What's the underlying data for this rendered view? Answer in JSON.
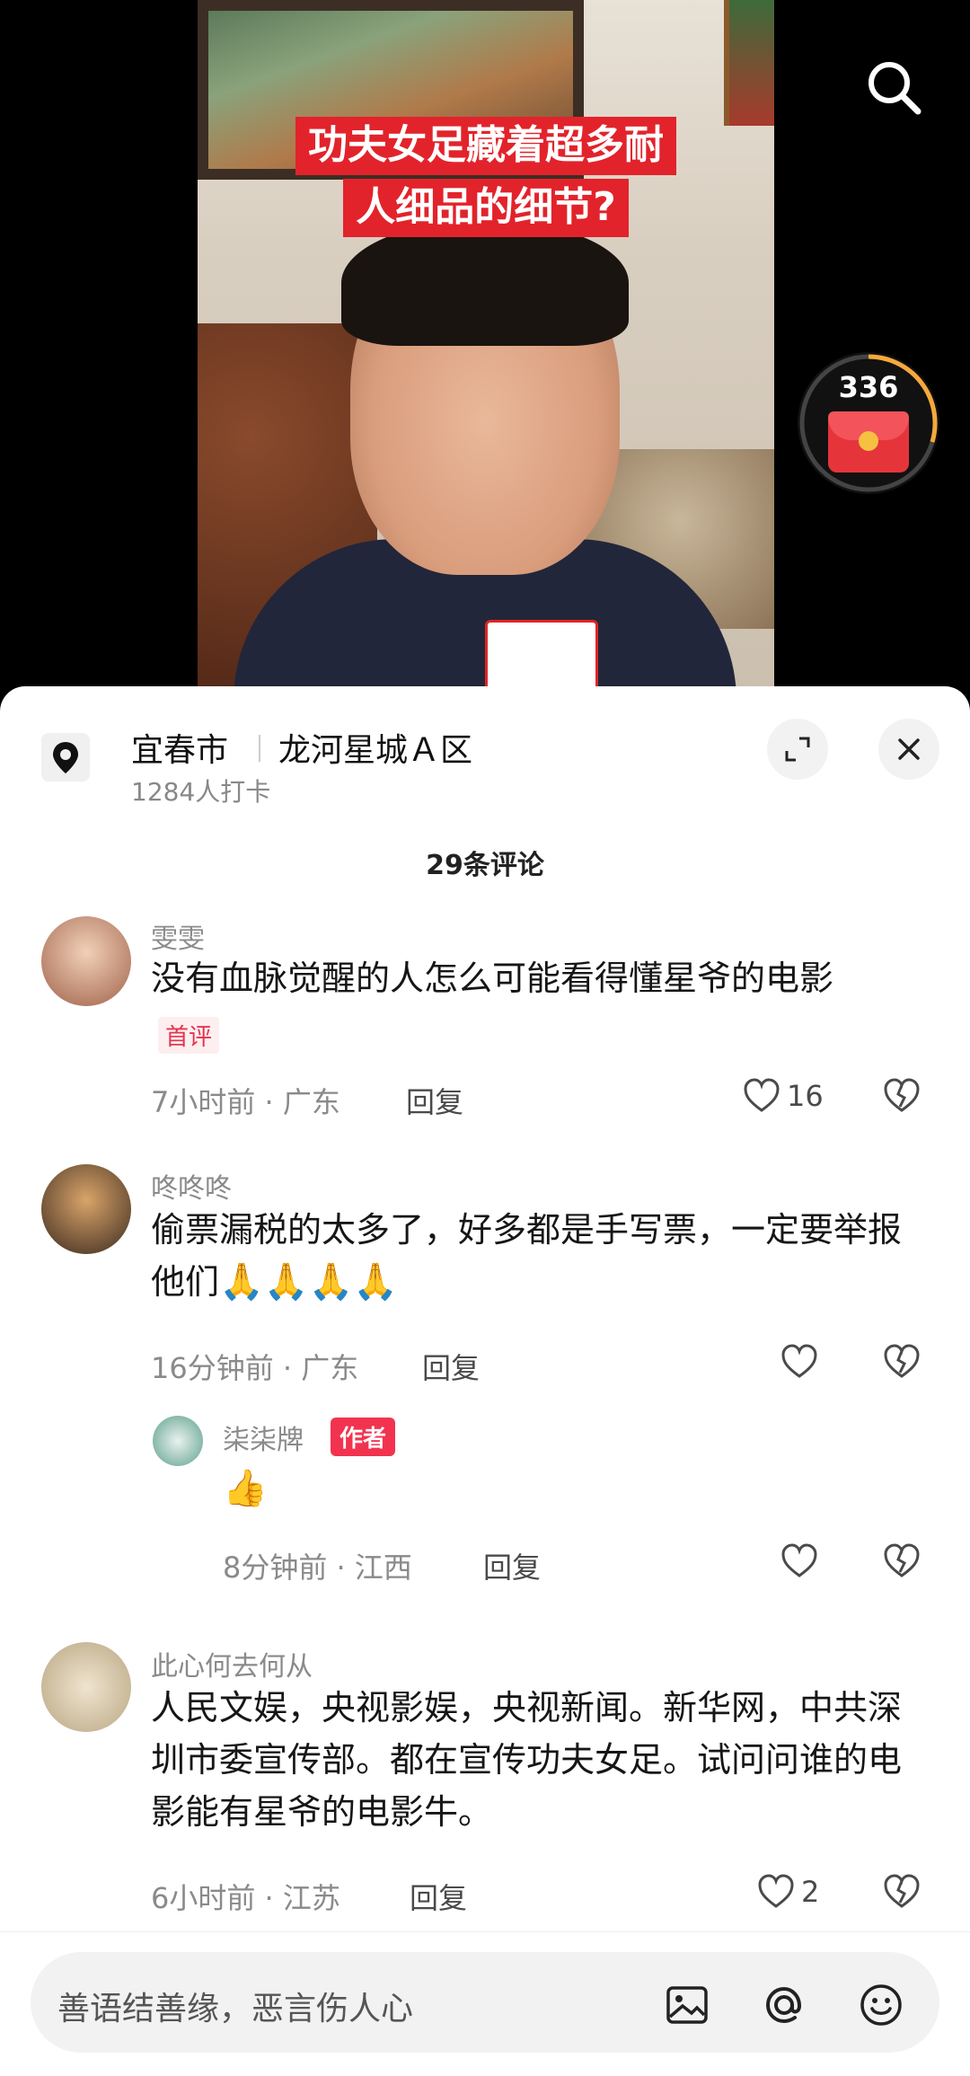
{
  "video": {
    "caption_line1": "功夫女足藏着超多耐",
    "caption_line2": "人细品的细节?",
    "redpacket_count": "336"
  },
  "location": {
    "city": "宜春市",
    "place": "龙河星城Ａ区",
    "checkins": "1284人打卡"
  },
  "comments_header": "29条评论",
  "comments": [
    {
      "user": "雯雯",
      "text": "没有血脉觉醒的人怎么可能看得懂星爷的电影",
      "badge": "首评",
      "time_location": "7小时前 · 广东",
      "reply_label": "回复",
      "likes": "16"
    },
    {
      "user": "咚咚咚",
      "text": "偷票漏税的太多了，好多都是手写票，一定要举报他们",
      "emoji": "🙏🙏🙏🙏",
      "time_location": "16分钟前 · 广东",
      "reply_label": "回复",
      "likes": ""
    },
    {
      "user": "柒柒牌",
      "author_badge": "作者",
      "emoji": "👍",
      "time_location": "8分钟前 · 江西",
      "reply_label": "回复",
      "likes": ""
    },
    {
      "user": "此心何去何从",
      "text": "人民文娱，央视影娱，央视新闻。新华网，中共深圳市委宣传部。都在宣传功夫女足。试问问谁的电影能有星爷的电影牛。",
      "time_location": "6小时前 · 江苏",
      "reply_label": "回复",
      "likes": "2"
    }
  ],
  "input": {
    "placeholder": "善语结善缘，恶言伤人心"
  },
  "icons": {
    "search": "search-icon",
    "location": "location-pin-icon",
    "expand": "expand-icon",
    "close": "close-icon",
    "like": "heart-icon",
    "dislike": "broken-heart-icon",
    "image": "image-icon",
    "mention": "at-icon",
    "emoji": "emoji-icon"
  },
  "colors": {
    "accent": "#f2334f",
    "caption_bg": "#e2232b",
    "text_primary": "#161616",
    "text_secondary": "#8a8a8a"
  }
}
